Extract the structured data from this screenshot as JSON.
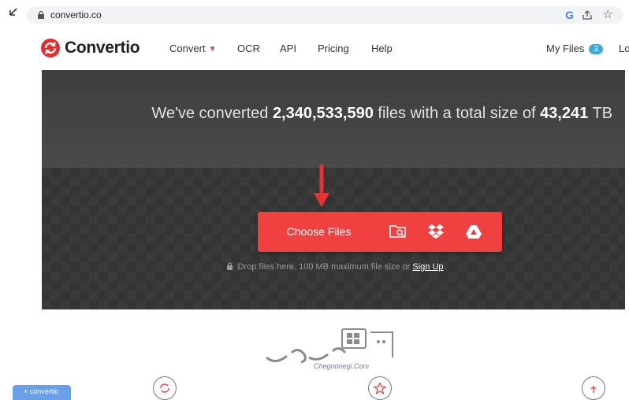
{
  "browser": {
    "url": "convertio.co"
  },
  "header": {
    "brand": "Convertio",
    "nav": [
      "Convert",
      "OCR",
      "API",
      "Pricing",
      "Help"
    ],
    "my_files_label": "My Files",
    "my_files_count": "3",
    "login_cut": "Lo"
  },
  "hero": {
    "stats_prefix": "We've converted",
    "files_count": "2,340,533,590",
    "stats_middle": "files with a total size of",
    "total_size": "43,241",
    "size_unit": "TB",
    "choose_files_label": "Choose Files",
    "drop_note": "Drop files here. 100 MB maximum file size or",
    "signup_label": "Sign Up"
  },
  "watermark": {
    "text": "Chegoonegi.Com"
  },
  "promo_tab": {
    "label": "+ convertio"
  },
  "colors": {
    "accent": "#f04040",
    "badge": "#3fa9dd",
    "hero_bg": "#464646"
  }
}
